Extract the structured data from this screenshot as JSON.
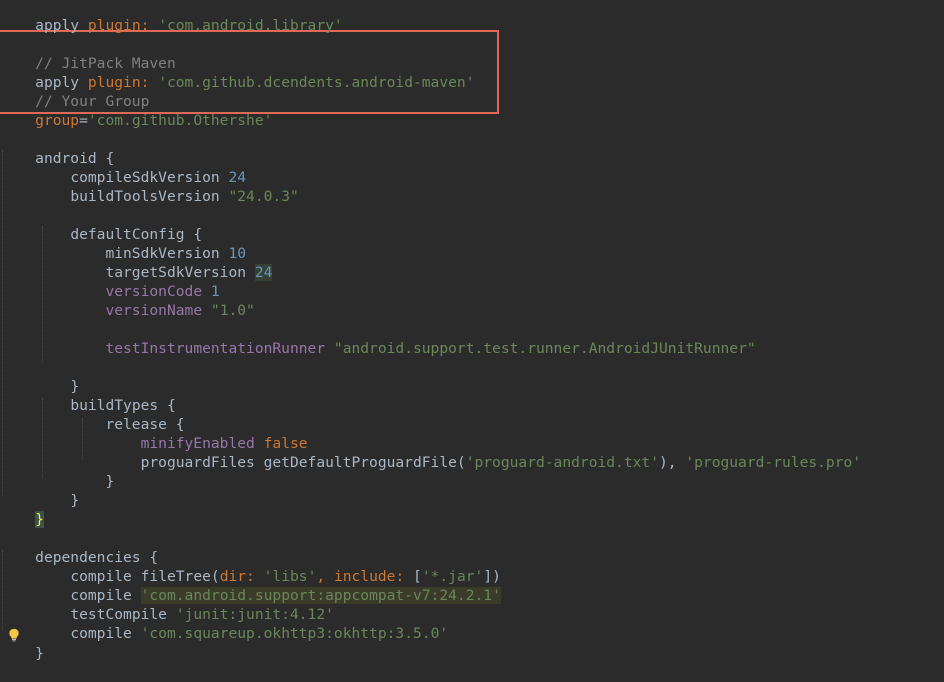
{
  "editor": {
    "lines": [
      [
        "apply",
        " ",
        "plugin: ",
        "'com.android.library'"
      ],
      [],
      [
        "// JitPack Maven"
      ],
      [
        "apply",
        " ",
        "plugin: ",
        "'com.github.dcendents.android-maven'"
      ],
      [
        "// Your Group"
      ],
      [
        "group",
        "=",
        "'com.github.Othershe'"
      ],
      [],
      [
        "android",
        " {"
      ],
      [
        "    ",
        "compileSdkVersion",
        " ",
        "24"
      ],
      [
        "    ",
        "buildToolsVersion",
        " ",
        "\"24.0.3\""
      ],
      [],
      [
        "    ",
        "defaultConfig",
        " {"
      ],
      [
        "        ",
        "minSdkVersion",
        " ",
        "10"
      ],
      [
        "        ",
        "targetSdkVersion",
        " ",
        "24"
      ],
      [
        "        ",
        "versionCode",
        " ",
        "1"
      ],
      [
        "        ",
        "versionName",
        " ",
        "\"1.0\""
      ],
      [],
      [
        "        ",
        "testInstrumentationRunner",
        " ",
        "\"android.support.test.runner.AndroidJUnitRunner\""
      ],
      [],
      [
        "    ",
        "}"
      ],
      [
        "    ",
        "buildTypes",
        " {"
      ],
      [
        "        ",
        "release",
        " {"
      ],
      [
        "            ",
        "minifyEnabled",
        " ",
        "false"
      ],
      [
        "            ",
        "proguardFiles getDefaultProguardFile(",
        "'proguard-android.txt'",
        "), ",
        "'proguard-rules.pro'"
      ],
      [
        "        ",
        "}"
      ],
      [
        "    ",
        "}"
      ],
      [
        "}"
      ],
      [],
      [
        "dependencies",
        " {"
      ],
      [
        "    ",
        "compile",
        " ",
        "fileTree(",
        "dir: ",
        "'libs'",
        ", ",
        "include: ",
        "[",
        "'*.jar'",
        "])"
      ],
      [
        "    ",
        "compile",
        " ",
        "'com.android.support:appcompat-v7:24.2.1'"
      ],
      [
        "    ",
        "testCompile",
        " ",
        "'junit:junit:4.12'"
      ],
      [
        "    ",
        "compile",
        " ",
        "'com.squareup.okhttp3:okhttp:3.5.0'"
      ],
      [],
      [
        "}"
      ]
    ],
    "highlight_box_lines": [
      2,
      5
    ],
    "gutter_icon": "lightbulb-icon",
    "colors": {
      "background": "#2b2b2b",
      "default_text": "#a9b7c6",
      "keyword": "#cc7832",
      "comment": "#808080",
      "string": "#6a8759",
      "number": "#6897bb",
      "highlight_box": "#e06a55"
    }
  }
}
